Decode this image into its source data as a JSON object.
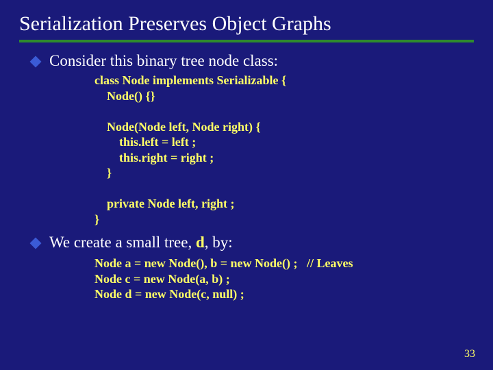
{
  "title": "Serialization Preserves Object Graphs",
  "bullets": {
    "b1": "Consider this binary tree node class:",
    "b2_pre": "We create a small tree, ",
    "b2_d": "d",
    "b2_post": ", by:"
  },
  "code1": {
    "l1": "class Node implements Serializable {",
    "l2": "    Node() {}",
    "l3": "    Node(Node left, Node right) {",
    "l4": "        this.left = left ;",
    "l5": "        this.right = right ;",
    "l6": "    }",
    "l7": "    private Node left, right ;",
    "l8": "}"
  },
  "code2": {
    "l1a": "Node a = new Node(), b = new Node() ;   ",
    "l1b": "// Leaves",
    "l2": "Node c = new Node(a, b) ;",
    "l3": "Node d = new Node(c, null) ;"
  },
  "pagenum": "33"
}
